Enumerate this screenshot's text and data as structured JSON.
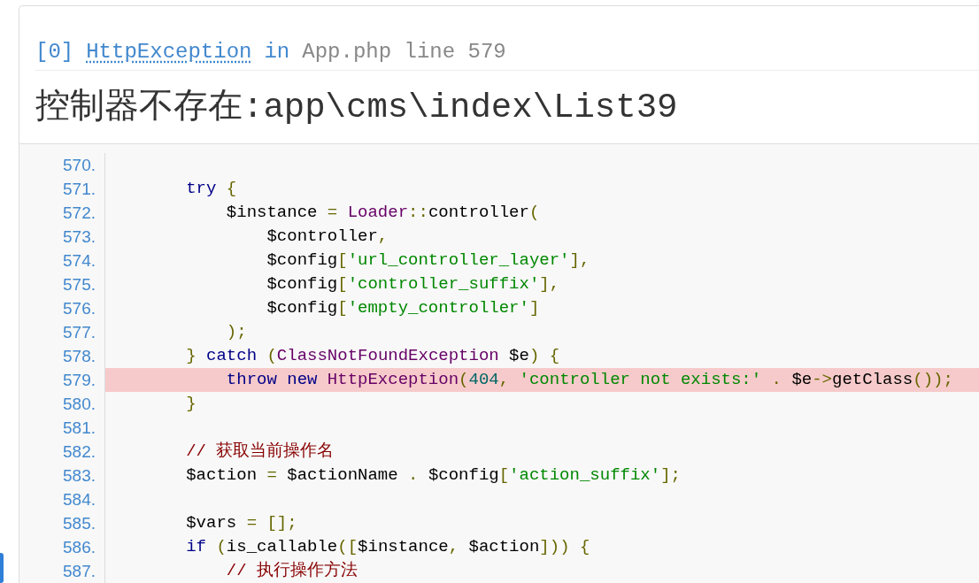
{
  "exception": {
    "index": "[0]",
    "class_name": "HttpException",
    "connector": "in",
    "location": "App.php line 579"
  },
  "message": "控制器不存在:app\\cms\\index\\List39",
  "source": {
    "lines": [
      {
        "number": "570.",
        "highlighted": false
      },
      {
        "number": "571.",
        "highlighted": false,
        "tokens": [
          {
            "kind": "kwd",
            "text": "        try"
          },
          {
            "kind": "pun",
            "text": " {"
          }
        ]
      },
      {
        "number": "572.",
        "highlighted": false,
        "tokens": [
          {
            "kind": "pln",
            "text": "            $instance "
          },
          {
            "kind": "pun",
            "text": "="
          },
          {
            "kind": "typ",
            "text": " Loader"
          },
          {
            "kind": "pun",
            "text": "::"
          },
          {
            "kind": "pln",
            "text": "controller"
          },
          {
            "kind": "pun",
            "text": "("
          }
        ]
      },
      {
        "number": "573.",
        "highlighted": false,
        "tokens": [
          {
            "kind": "pln",
            "text": "                $controller"
          },
          {
            "kind": "pun",
            "text": ","
          }
        ]
      },
      {
        "number": "574.",
        "highlighted": false,
        "tokens": [
          {
            "kind": "pln",
            "text": "                $config"
          },
          {
            "kind": "pun",
            "text": "["
          },
          {
            "kind": "str",
            "text": "'url_controller_layer'"
          },
          {
            "kind": "pun",
            "text": "],"
          }
        ]
      },
      {
        "number": "575.",
        "highlighted": false,
        "tokens": [
          {
            "kind": "pln",
            "text": "                $config"
          },
          {
            "kind": "pun",
            "text": "["
          },
          {
            "kind": "str",
            "text": "'controller_suffix'"
          },
          {
            "kind": "pun",
            "text": "],"
          }
        ]
      },
      {
        "number": "576.",
        "highlighted": false,
        "tokens": [
          {
            "kind": "pln",
            "text": "                $config"
          },
          {
            "kind": "pun",
            "text": "["
          },
          {
            "kind": "str",
            "text": "'empty_controller'"
          },
          {
            "kind": "pun",
            "text": "]"
          }
        ]
      },
      {
        "number": "577.",
        "highlighted": false,
        "tokens": [
          {
            "kind": "pun",
            "text": "            );"
          }
        ]
      },
      {
        "number": "578.",
        "highlighted": false,
        "tokens": [
          {
            "kind": "pun",
            "text": "        }"
          },
          {
            "kind": "kwd",
            "text": " catch"
          },
          {
            "kind": "pun",
            "text": " ("
          },
          {
            "kind": "typ",
            "text": "ClassNotFoundException"
          },
          {
            "kind": "pln",
            "text": " $e"
          },
          {
            "kind": "pun",
            "text": ") {"
          }
        ]
      },
      {
        "number": "579.",
        "highlighted": true,
        "tokens": [
          {
            "kind": "kwd",
            "text": "            throw new"
          },
          {
            "kind": "typ",
            "text": " HttpException"
          },
          {
            "kind": "pun",
            "text": "("
          },
          {
            "kind": "lit",
            "text": "404"
          },
          {
            "kind": "pun",
            "text": ","
          },
          {
            "kind": "str",
            "text": " 'controller not exists:'"
          },
          {
            "kind": "pun",
            "text": " ."
          },
          {
            "kind": "pln",
            "text": " $e"
          },
          {
            "kind": "pun",
            "text": "->"
          },
          {
            "kind": "pln",
            "text": "getClass"
          },
          {
            "kind": "pun",
            "text": "());"
          }
        ]
      },
      {
        "number": "580.",
        "highlighted": false,
        "tokens": [
          {
            "kind": "pun",
            "text": "        }"
          }
        ]
      },
      {
        "number": "581.",
        "highlighted": false
      },
      {
        "number": "582.",
        "highlighted": false,
        "tokens": [
          {
            "kind": "com",
            "text": "        // 获取当前操作名"
          }
        ]
      },
      {
        "number": "583.",
        "highlighted": false,
        "tokens": [
          {
            "kind": "pln",
            "text": "        $action "
          },
          {
            "kind": "pun",
            "text": "="
          },
          {
            "kind": "pln",
            "text": " $actionName "
          },
          {
            "kind": "pun",
            "text": "."
          },
          {
            "kind": "pln",
            "text": " $config"
          },
          {
            "kind": "pun",
            "text": "["
          },
          {
            "kind": "str",
            "text": "'action_suffix'"
          },
          {
            "kind": "pun",
            "text": "];"
          }
        ]
      },
      {
        "number": "584.",
        "highlighted": false
      },
      {
        "number": "585.",
        "highlighted": false,
        "tokens": [
          {
            "kind": "pln",
            "text": "        $vars "
          },
          {
            "kind": "pun",
            "text": "= [];"
          }
        ]
      },
      {
        "number": "586.",
        "highlighted": false,
        "tokens": [
          {
            "kind": "kwd",
            "text": "        if"
          },
          {
            "kind": "pun",
            "text": " ("
          },
          {
            "kind": "pln",
            "text": "is_callable"
          },
          {
            "kind": "pun",
            "text": "(["
          },
          {
            "kind": "pln",
            "text": "$instance"
          },
          {
            "kind": "pun",
            "text": ","
          },
          {
            "kind": "pln",
            "text": " $action"
          },
          {
            "kind": "pun",
            "text": "])) {"
          }
        ]
      },
      {
        "number": "587.",
        "highlighted": false,
        "tokens": [
          {
            "kind": "com",
            "text": "            // 执行操作方法"
          }
        ]
      }
    ]
  }
}
